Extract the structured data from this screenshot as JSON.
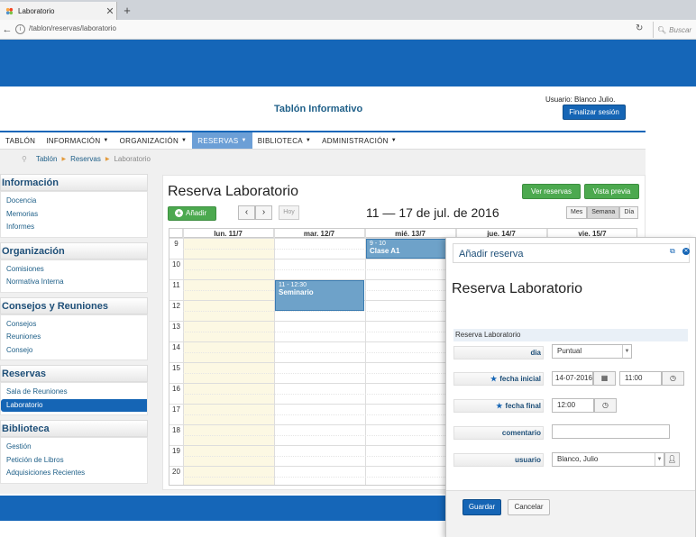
{
  "browser": {
    "tab_title": "Laboratorio",
    "tab_close": "✕",
    "new_tab": "+",
    "url": "/tablon/reservas/laboratorio",
    "search_placeholder": "Buscar"
  },
  "header": {
    "site_title": "Tablón Informativo",
    "user_label": "Usuario: Blanco  Julio.",
    "logout_label": "Finalizar sesión"
  },
  "nav": {
    "items": [
      {
        "label": "TABLÓN",
        "caret": ""
      },
      {
        "label": "INFORMACIÓN",
        "caret": "▼"
      },
      {
        "label": "ORGANIZACIÓN",
        "caret": "▼"
      },
      {
        "label": "RESERVAS",
        "caret": "▼"
      },
      {
        "label": "BIBLIOTECA",
        "caret": "▼"
      },
      {
        "label": "ADMINISTRACIÓN",
        "caret": "▼"
      }
    ],
    "active": "RESERVAS"
  },
  "breadcrumb": {
    "items": [
      "Tablón",
      "Reservas",
      "Laboratorio"
    ]
  },
  "sidebar": {
    "sections": [
      {
        "title": "Información",
        "links": [
          "Docencia",
          "Memorias",
          "Informes"
        ]
      },
      {
        "title": "Organización",
        "links": [
          "Comisiones",
          "Normativa Interna"
        ]
      },
      {
        "title": "Consejos y Reuniones",
        "links": [
          "Consejos",
          "Reuniones",
          "Consejo"
        ]
      },
      {
        "title": "Reservas",
        "links": [
          "Sala de Reuniones",
          "Laboratorio"
        ]
      },
      {
        "title": "Biblioteca",
        "links": [
          "Gestión",
          "Petición de Libros",
          "Adquisiciones Recientes"
        ]
      }
    ],
    "active_link": "Laboratorio"
  },
  "main": {
    "title": "Reserva Laboratorio",
    "btn_reservas": "Ver reservas",
    "btn_preview": "Vista previa",
    "btn_add": "Añadir",
    "btn_prev": "‹",
    "btn_next": "›",
    "btn_today": "Hoy",
    "range": "11 — 17 de jul. de 2016",
    "views": [
      "Mes",
      "Semana",
      "Día"
    ],
    "active_view": "Semana"
  },
  "calendar": {
    "days": [
      "lun. 11/7",
      "mar. 12/7",
      "mié. 13/7",
      "jue. 14/7",
      "vie. 15/7"
    ],
    "hours": [
      "9",
      "10",
      "11",
      "12",
      "13",
      "14",
      "15",
      "16",
      "17",
      "18",
      "19",
      "20"
    ],
    "events": [
      {
        "time": "9 - 10",
        "name": "Clase A1",
        "day": 2,
        "start": 9,
        "end": 10
      },
      {
        "time": "11 - 12:30",
        "name": "Seminario",
        "day": 1,
        "start": 11,
        "end": 12.5
      }
    ]
  },
  "modal": {
    "header_title": "Añadir reserva",
    "big_title": "Reserva Laboratorio",
    "section_label": "Reserva Laboratorio",
    "fields": {
      "dia_label": "dia",
      "dia_value": "Puntual",
      "fecha_inicial_label": "fecha inicial",
      "fecha_inicial_date": "14-07-2016",
      "fecha_inicial_time": "11:00",
      "fecha_final_label": "fecha final",
      "fecha_final_time": "12:00",
      "comentario_label": "comentario",
      "comentario_value": "",
      "usuario_label": "usuario",
      "usuario_value": "Blanco, Julio"
    },
    "save_label": "Guardar",
    "cancel_label": "Cancelar"
  },
  "colors": {
    "brand_blue": "#1566b8",
    "nav_active": "#6c9fd6",
    "green": "#4ca94f",
    "event": "#6ea2c9",
    "today_column": "#fcf8e3"
  }
}
